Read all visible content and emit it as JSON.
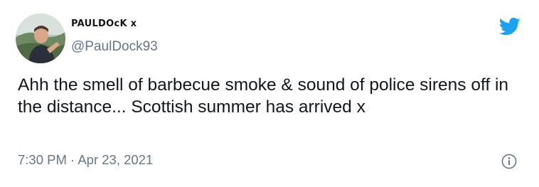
{
  "user": {
    "display_name": "PAULDOcK x",
    "handle": "@PaulDock93",
    "avatar_icon": "profile-photo"
  },
  "tweet": {
    "text": "Ahh the smell of barbecue smoke & sound of police sirens off in the distance... Scottish summer has arrived x",
    "timestamp": "7:30 PM · Apr 23, 2021"
  },
  "icons": {
    "brand": "twitter-bird-icon",
    "info": "info-icon"
  },
  "colors": {
    "brand": "#1da1f2",
    "text": "#14171a",
    "secondary": "#657786",
    "background": "#ffffff"
  }
}
